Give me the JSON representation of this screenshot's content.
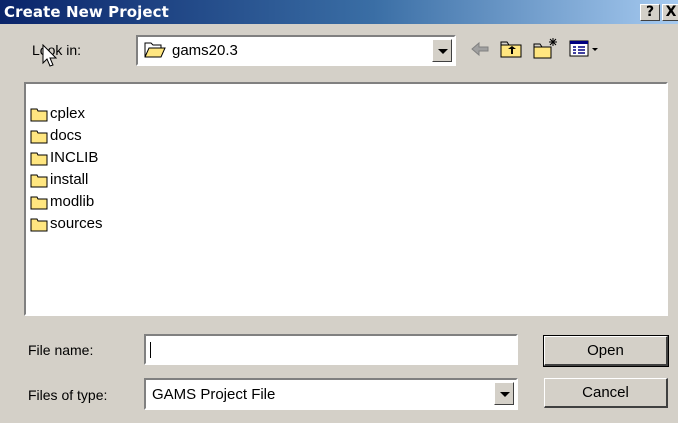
{
  "window": {
    "title": "Create New Project",
    "help_label": "?",
    "close_label": "X"
  },
  "lookin": {
    "label": "Look in:",
    "value": "gams20.3"
  },
  "toolbar": {
    "icons": [
      "back-arrow-icon",
      "up-one-level-icon",
      "create-new-folder-icon",
      "view-menu-icon"
    ]
  },
  "files": [
    {
      "name": "cplex",
      "icon": "folder-icon"
    },
    {
      "name": "docs",
      "icon": "folder-icon"
    },
    {
      "name": "INCLIB",
      "icon": "folder-icon"
    },
    {
      "name": "install",
      "icon": "folder-icon"
    },
    {
      "name": "modlib",
      "icon": "folder-icon"
    },
    {
      "name": "sources",
      "icon": "folder-icon"
    }
  ],
  "form": {
    "filename_label": "File name:",
    "filename_value": "",
    "filetype_label": "Files of type:",
    "filetype_value": "GAMS Project File"
  },
  "buttons": {
    "open": "Open",
    "cancel": "Cancel"
  },
  "colors": {
    "titlebar_start": "#0a246a",
    "titlebar_end": "#a6caf0",
    "dialog_bg": "#d4d0c8",
    "folder_yellow": "#ffe680"
  }
}
